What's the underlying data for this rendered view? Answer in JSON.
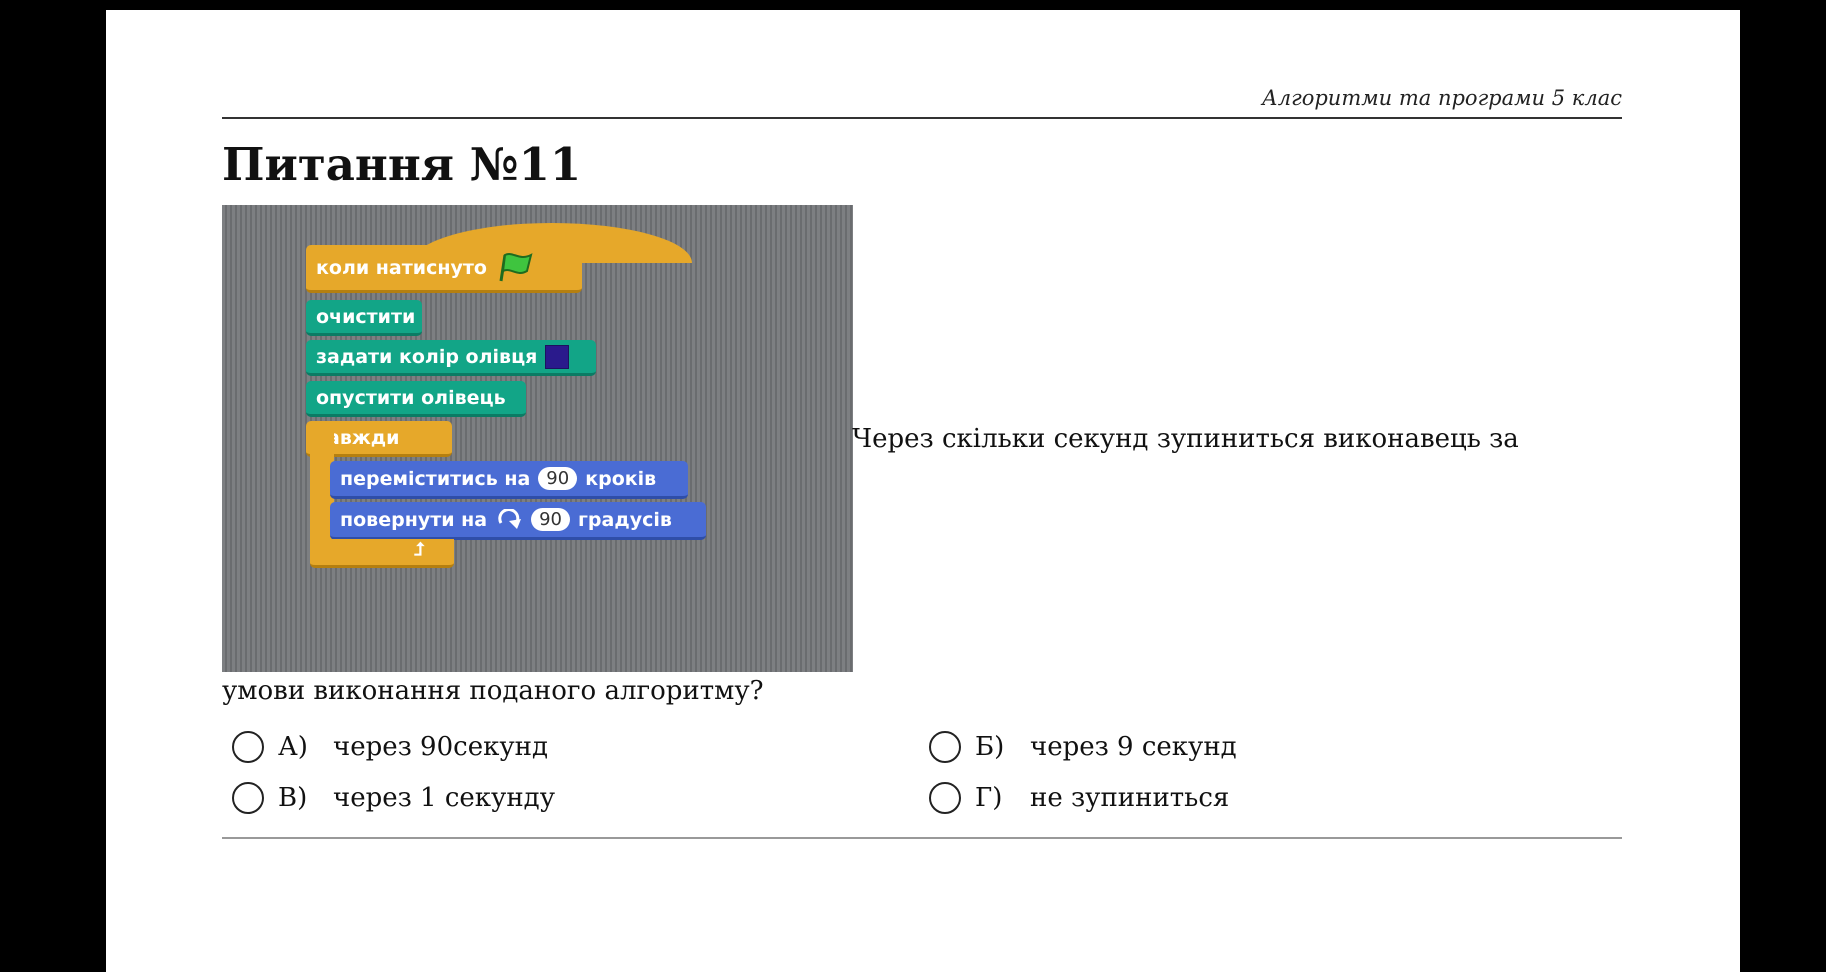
{
  "header": {
    "subtitle": "Алгоритми та програми 5 клас"
  },
  "question": {
    "title": "Питання №11",
    "text_part1": "Через скільки секунд зупиниться виконавець за",
    "text_part2": "умови виконання поданого алгоритму?"
  },
  "scratch_script": {
    "when_flag": "коли натиснуто",
    "clear": "очистити",
    "set_pen_color": "задати колір олівця",
    "pen_color": "#2a1a8c",
    "pen_down": "опустити олівець",
    "forever": "завжди",
    "move_label": "переміститись на",
    "move_value": "90",
    "move_unit": "кроків",
    "turn_label": "повернути на",
    "turn_value": "90",
    "turn_unit": "градусів",
    "colors": {
      "events": "#e6a82a",
      "pen": "#12a587",
      "motion": "#4a6cd4",
      "background": "#7d7f82"
    }
  },
  "options": [
    {
      "letter": "А)",
      "text": "через 90секунд"
    },
    {
      "letter": "Б)",
      "text": "через 9 секунд"
    },
    {
      "letter": "В)",
      "text": "через 1 секунду"
    },
    {
      "letter": "Г)",
      "text": "не зупиниться"
    }
  ]
}
